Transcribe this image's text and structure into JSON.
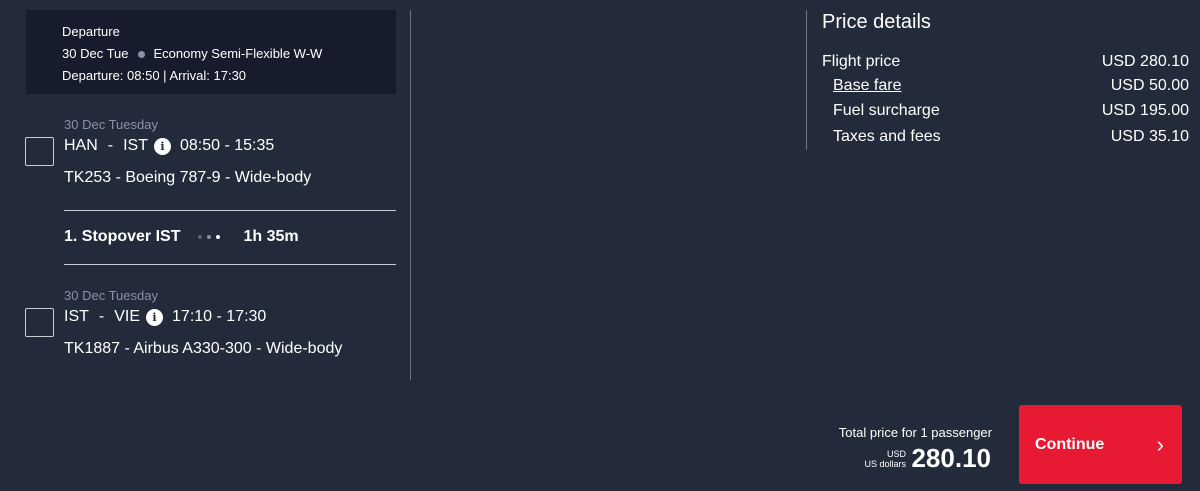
{
  "departure_card": {
    "heading": "Departure",
    "date": "30 Dec Tue",
    "fare_class": "Economy Semi-Flexible W-W",
    "times": "Departure: 08:50 | Arrival: 17:30"
  },
  "segments": [
    {
      "date": "30 Dec Tuesday",
      "from": "HAN",
      "dash": "-",
      "to": "IST",
      "time": "08:50 - 15:35",
      "flight": "TK253 - Boeing 787-9 - Wide-body"
    },
    {
      "date": "30 Dec Tuesday",
      "from": "IST",
      "dash": "-",
      "to": "VIE",
      "time": "17:10 - 17:30",
      "flight": "TK1887 - Airbus A330-300 - Wide-body"
    }
  ],
  "stopover": {
    "label": "1. Stopover IST",
    "duration": "1h 35m"
  },
  "price_details": {
    "title": "Price details",
    "rows": [
      {
        "label": "Flight price",
        "value": "USD 280.10"
      },
      {
        "label": "Base fare",
        "value": "USD 50.00"
      },
      {
        "label": "Fuel surcharge",
        "value": "USD 195.00"
      },
      {
        "label": "Taxes and fees",
        "value": "USD 35.10"
      }
    ]
  },
  "total": {
    "label": "Total price for 1 passenger",
    "currency_code": "USD",
    "currency_name": "US dollars",
    "amount": "280.10"
  },
  "continue_button": {
    "label": "Continue",
    "icon": "chevron-right-icon"
  },
  "colors": {
    "background": "#232a3a",
    "card": "#161c2b",
    "accent": "#e81932"
  }
}
